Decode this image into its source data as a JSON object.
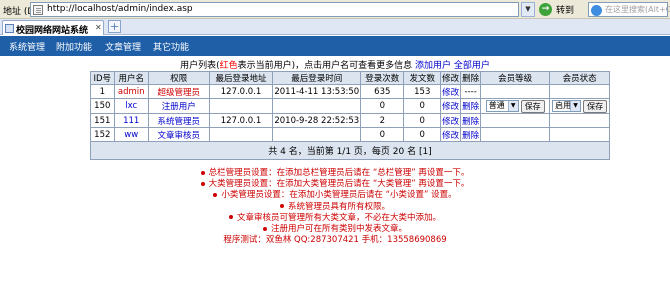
{
  "browser": {
    "address_label": "地址 (D)",
    "url": "http://localhost/admin/index.asp",
    "go_label": "转到",
    "search_placeholder": "在这里搜索(Alt+C)",
    "tab_title": "校园网络网站系统"
  },
  "nav": {
    "items": [
      {
        "label": "系统管理"
      },
      {
        "label": "附加功能"
      },
      {
        "label": "文章管理"
      },
      {
        "label": "其它功能"
      }
    ]
  },
  "intro": {
    "prefix": "用户列表(",
    "red_word": "红色",
    "middle": "表示当前用户)，点击用户名可查看更多信息",
    "add_user": "添加用户",
    "all_users": "全部用户"
  },
  "table": {
    "headers": [
      "ID号",
      "用户名",
      "权限",
      "最后登录地址",
      "最后登录时间",
      "登录次数",
      "发文数",
      "修改",
      "删除",
      "会员等级",
      "会员状态"
    ],
    "rows": [
      {
        "id": "1",
        "username": "admin",
        "role": "超级管理员",
        "ip": "127.0.0.1",
        "time": "2011-4-11 13:53:50",
        "logins": "635",
        "posts": "153",
        "edit": "修改",
        "del": "----",
        "level": "",
        "level_save": "",
        "status": "",
        "status_save": ""
      },
      {
        "id": "150",
        "username": "lxc",
        "role": "注册用户",
        "ip": "",
        "time": "",
        "logins": "0",
        "posts": "0",
        "edit": "修改",
        "del": "删除",
        "level": "普通",
        "level_save": "保存",
        "status": "启用",
        "status_save": "保存"
      },
      {
        "id": "151",
        "username": "111",
        "role": "系统管理员",
        "ip": "127.0.0.1",
        "time": "2010-9-28 22:52:53",
        "logins": "2",
        "posts": "0",
        "edit": "修改",
        "del": "删除",
        "level": "",
        "level_save": "",
        "status": "",
        "status_save": ""
      },
      {
        "id": "152",
        "username": "ww",
        "role": "文章审核员",
        "ip": "",
        "time": "",
        "logins": "0",
        "posts": "0",
        "edit": "修改",
        "del": "删除",
        "level": "",
        "level_save": "",
        "status": "",
        "status_save": ""
      }
    ],
    "footer": "共 4 名，当前第 1/1 页，每页 20 名 [1]"
  },
  "notes": [
    "总栏管理员设置：在添加总栏管理员后请在 “总栏管理” 再设置一下。",
    "大类管理员设置：在添加大类管理员后请在 “大类管理” 再设置一下。",
    "小类管理员设置：在添加小类管理员后请在 “小类设置” 设置。",
    "系统管理员具有所有权限。",
    "文章审核员可管理所有大类文章，不必在大类中添加。",
    "注册用户可在所有类别中发表文章。"
  ],
  "contact": "程序测试：双鱼林 QQ:287307421 手机：13558690869",
  "colors": {
    "nav_bg": "#1f5fa8",
    "highlight": "#cc0000",
    "link": "#0000cc",
    "header_bg": "#dbe4ef"
  }
}
